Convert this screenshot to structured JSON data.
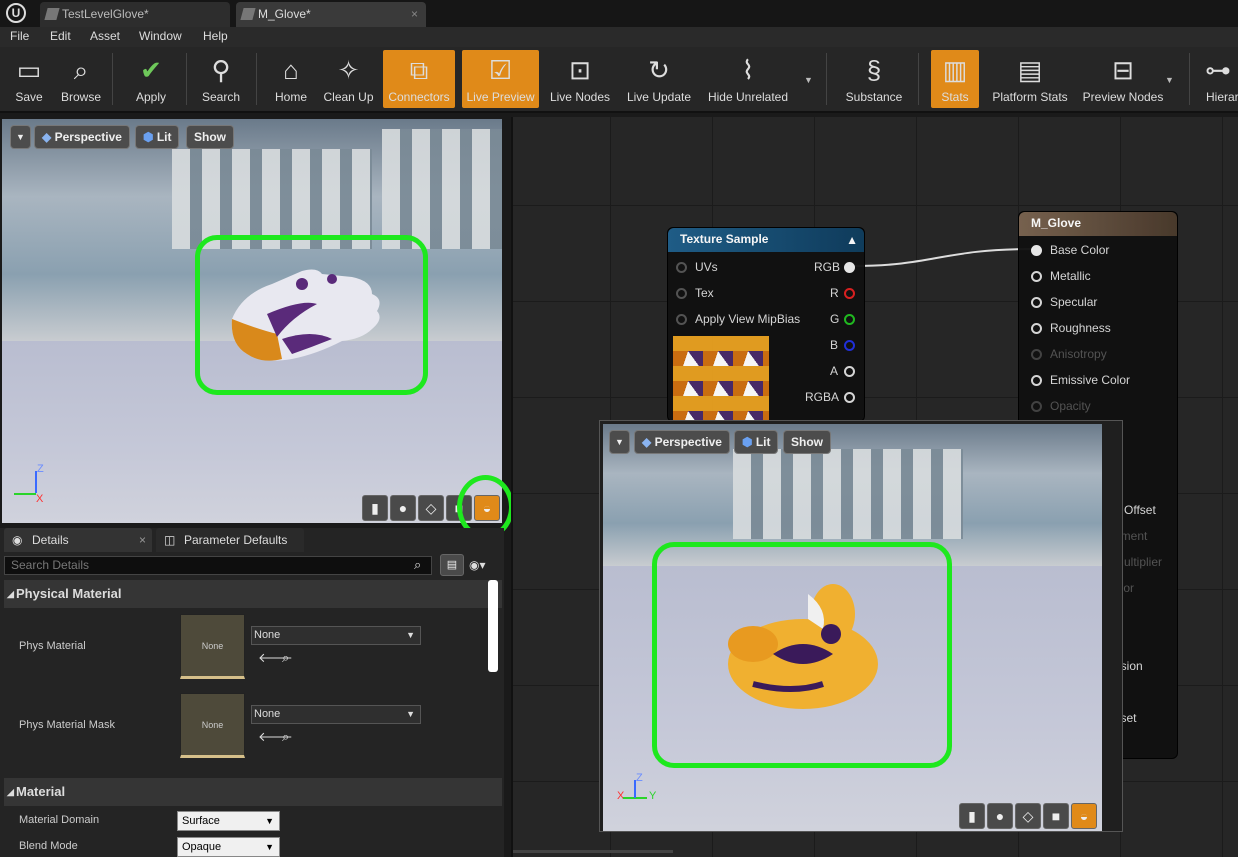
{
  "tabs": [
    {
      "label": "TestLevelGlove*"
    },
    {
      "label": "M_Glove*"
    }
  ],
  "menu": [
    "File",
    "Edit",
    "Asset",
    "Window",
    "Help"
  ],
  "toolbar": {
    "save": "Save",
    "browse": "Browse",
    "apply": "Apply",
    "search": "Search",
    "home": "Home",
    "clean_up": "Clean Up",
    "connectors": "Connectors",
    "live_preview": "Live Preview",
    "live_nodes": "Live Nodes",
    "live_update": "Live Update",
    "hide_unrelated": "Hide Unrelated",
    "substance": "Substance",
    "stats": "Stats",
    "platform_stats": "Platform Stats",
    "preview_nodes": "Preview Nodes",
    "hierarchy": "Hierar"
  },
  "viewport": {
    "perspective": "Perspective",
    "lit": "Lit",
    "show": "Show",
    "axis_z": "Z",
    "axis_x": "X",
    "axis_y": "Y"
  },
  "details": {
    "tab_details": "Details",
    "tab_params": "Parameter Defaults",
    "search_placeholder": "Search Details",
    "cat_physical": "Physical Material",
    "phys_material": "Phys Material",
    "phys_material_mask": "Phys Material Mask",
    "none_thumb": "None",
    "none_value": "None",
    "cat_material": "Material",
    "material_domain": "Material Domain",
    "material_domain_value": "Surface",
    "blend_mode": "Blend Mode",
    "blend_mode_value": "Opaque"
  },
  "texture_node": {
    "title": "Texture Sample",
    "inputs": [
      "UVs",
      "Tex",
      "Apply View MipBias"
    ],
    "outputs": [
      "RGB",
      "R",
      "G",
      "B",
      "A",
      "RGBA"
    ]
  },
  "material_node": {
    "title": "M_Glove",
    "pins": [
      "Base Color",
      "Metallic",
      "Specular",
      "Roughness",
      "Anisotropy",
      "Emissive Color",
      "Opacity"
    ],
    "partial": [
      "n Offset",
      "ement",
      "Multiplier",
      "olor",
      "D",
      "l",
      "usion",
      "ffset",
      "el"
    ]
  },
  "colors": {
    "accent": "#e08a19",
    "highlight": "#1ee81e",
    "pin_r": "#e02020",
    "pin_g": "#20c020",
    "pin_b": "#2030e0"
  }
}
